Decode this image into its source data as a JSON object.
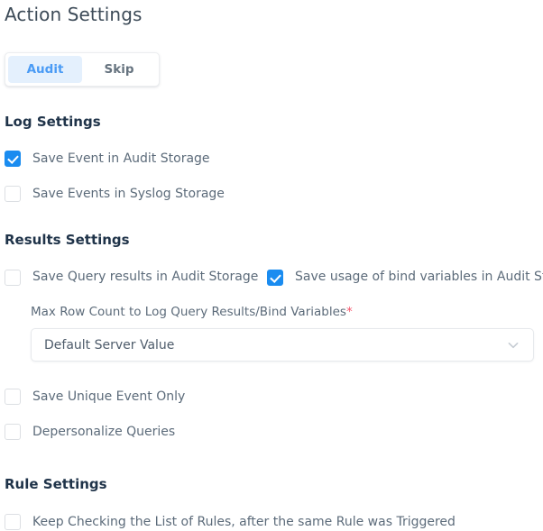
{
  "page": {
    "title": "Action Settings"
  },
  "tabs": [
    {
      "label": "Audit",
      "active": true
    },
    {
      "label": "Skip",
      "active": false
    }
  ],
  "sections": {
    "log": {
      "heading": "Log Settings",
      "options": [
        {
          "label": "Save Event in Audit Storage",
          "checked": true
        },
        {
          "label": "Save Events in Syslog Storage",
          "checked": false
        }
      ]
    },
    "results": {
      "heading": "Results Settings",
      "options_left": [
        {
          "label": "Save Query results in Audit Storage",
          "checked": false
        }
      ],
      "options_right": [
        {
          "label": "Save usage of bind variables in Audit Storage",
          "checked": true
        }
      ],
      "field": {
        "label": "Max Row Count to Log Query Results/Bind Variables",
        "required_marker": "*",
        "value": "Default Server Value",
        "icon": "chevron-down-icon"
      },
      "options_lower": [
        {
          "label": "Save Unique Event Only",
          "checked": false
        },
        {
          "label": "Depersonalize Queries",
          "checked": false
        }
      ]
    },
    "rule": {
      "heading": "Rule Settings",
      "options": [
        {
          "label": "Keep Checking the List of Rules, after the same Rule was Triggered",
          "checked": false
        }
      ]
    }
  },
  "colors": {
    "accent_checked": "#1a8cf0",
    "tab_active_bg": "#e4f0fd",
    "tab_active_text": "#4a9bf5",
    "heading": "#1f3349",
    "label": "#5c6b7a",
    "required": "#f4556c",
    "background": "#ffffff"
  }
}
